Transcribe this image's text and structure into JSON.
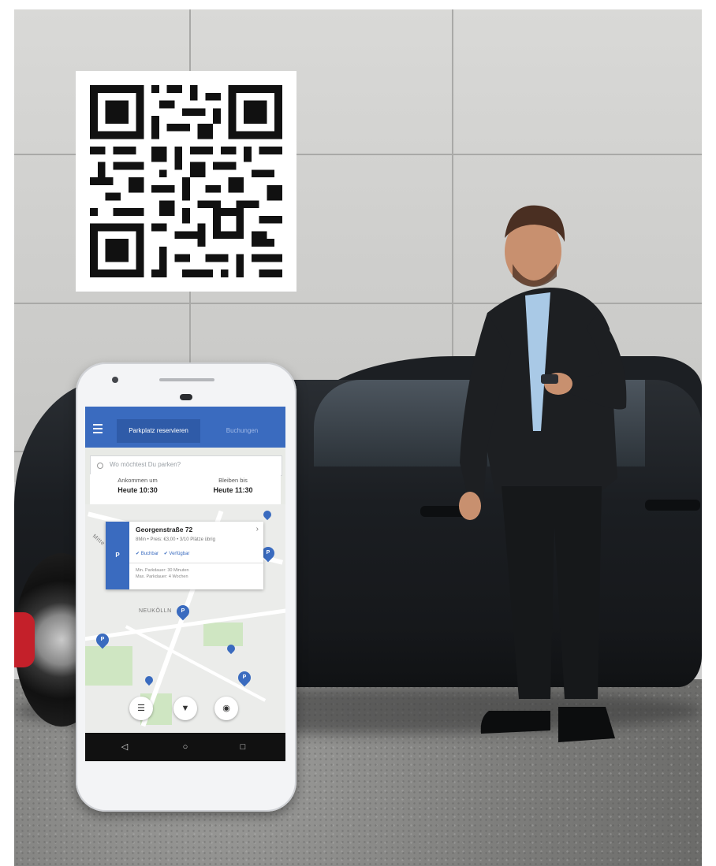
{
  "app": {
    "tabs": [
      {
        "label": "Parkplatz reservieren"
      },
      {
        "label": "Buchungen"
      }
    ],
    "search": {
      "placeholder": "Wo möchtest Du parken?"
    },
    "times": {
      "arrive": {
        "label": "Ankommen um",
        "value": "Heute 10:30"
      },
      "stay": {
        "label": "Bleiben bis",
        "value": "Heute 11:30"
      }
    },
    "map": {
      "district_label": "NEUKÖLLN",
      "street_label": "Mitte"
    },
    "card": {
      "marker": "P",
      "title": "Georgenstraße 72",
      "subtitle": "8Min • Preis: €3,00 • 3/10 Plätze übrig",
      "badge_bookable": "✔ Buchbar",
      "badge_available": "✔ Verfügbar",
      "info_min": "Min. Parkdauer: 30 Minuten",
      "info_max": "Max. Parkdauer: 4 Wochen"
    },
    "pins": [
      {
        "label": "P"
      },
      {
        "label": "P"
      },
      {
        "label": "P"
      },
      {
        "label": "P"
      }
    ],
    "fabs": [
      {
        "icon": "sort-icon"
      },
      {
        "icon": "filter-icon"
      },
      {
        "icon": "location-icon"
      }
    ],
    "nav": [
      {
        "icon": "back-icon"
      },
      {
        "icon": "home-icon"
      },
      {
        "icon": "recents-icon"
      }
    ]
  },
  "colors": {
    "brand": "#3a6bbf",
    "brand_dark": "#2f5ba8"
  }
}
